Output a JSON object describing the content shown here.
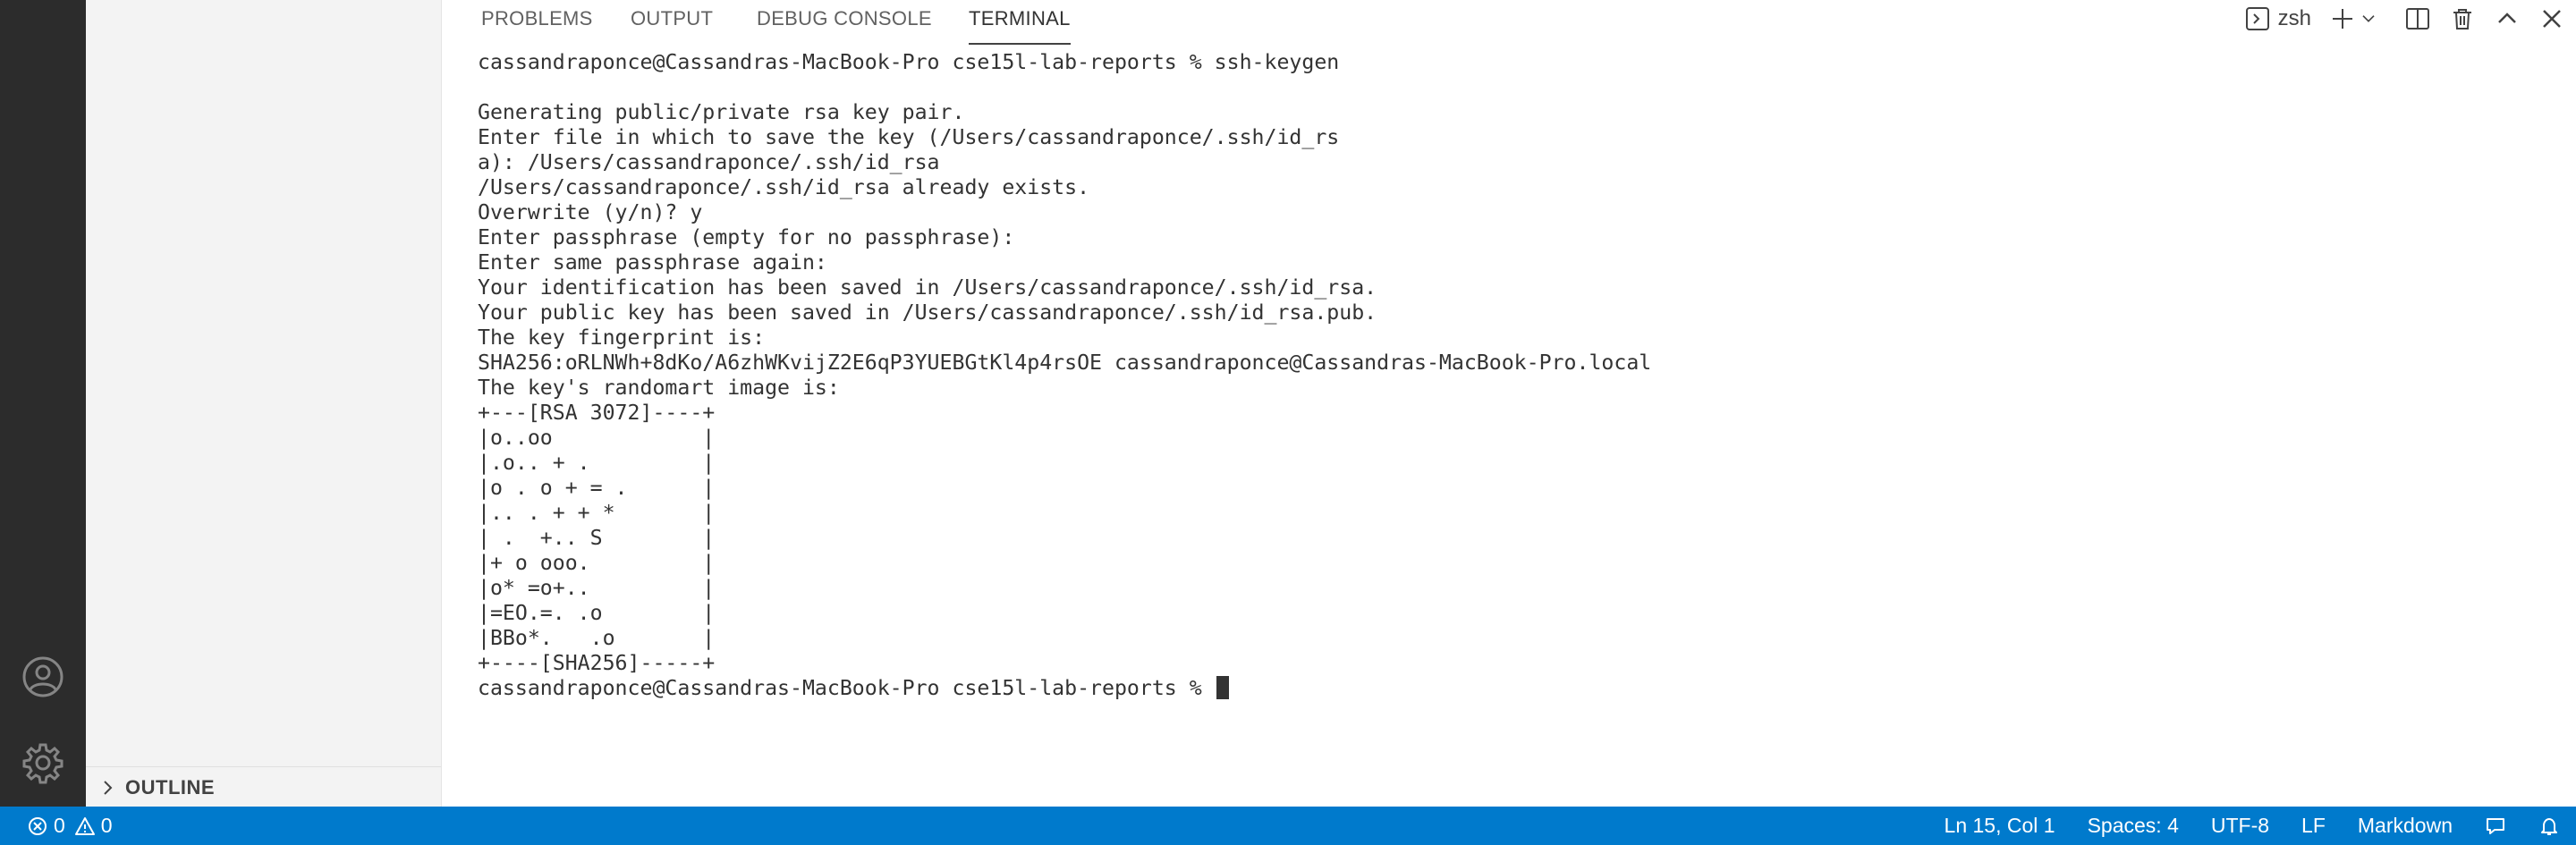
{
  "activity_bar": {
    "icons": [
      "account-icon",
      "settings-gear-icon"
    ]
  },
  "sidebar": {
    "outline_label": "OUTLINE"
  },
  "panel": {
    "tabs": [
      {
        "label": "PROBLEMS",
        "active": false
      },
      {
        "label": "OUTPUT",
        "active": false
      },
      {
        "label": "DEBUG CONSOLE",
        "active": false
      },
      {
        "label": "TERMINAL",
        "active": true
      }
    ],
    "shell_name": "zsh"
  },
  "terminal": {
    "lines": [
      "cassandraponce@Cassandras-MacBook-Pro cse15l-lab-reports % ssh-keygen",
      "",
      "Generating public/private rsa key pair.",
      "Enter file in which to save the key (/Users/cassandraponce/.ssh/id_rs",
      "a): /Users/cassandraponce/.ssh/id_rsa",
      "/Users/cassandraponce/.ssh/id_rsa already exists.",
      "Overwrite (y/n)? y",
      "Enter passphrase (empty for no passphrase):",
      "Enter same passphrase again:",
      "Your identification has been saved in /Users/cassandraponce/.ssh/id_rsa.",
      "Your public key has been saved in /Users/cassandraponce/.ssh/id_rsa.pub.",
      "The key fingerprint is:",
      "SHA256:oRLNWh+8dKo/A6zhWKvijZ2E6qP3YUEBGtKl4p4rsOE cassandraponce@Cassandras-MacBook-Pro.local",
      "The key's randomart image is:",
      "+---[RSA 3072]----+",
      "|o..oo            |",
      "|.o.. + .         |",
      "|o . o + = .      |",
      "|.. . + + *       |",
      "| .  +.. S        |",
      "|+ o ooo.         |",
      "|o* =o+..         |",
      "|=EO.=. .o        |",
      "|BBo*.   .o       |",
      "+----[SHA256]-----+"
    ],
    "prompt": "cassandraponce@Cassandras-MacBook-Pro cse15l-lab-reports % "
  },
  "status_bar": {
    "errors": "0",
    "warnings": "0",
    "position": "Ln 15, Col 1",
    "spaces": "Spaces: 4",
    "encoding": "UTF-8",
    "eol": "LF",
    "language": "Markdown",
    "color": "#007acc"
  }
}
